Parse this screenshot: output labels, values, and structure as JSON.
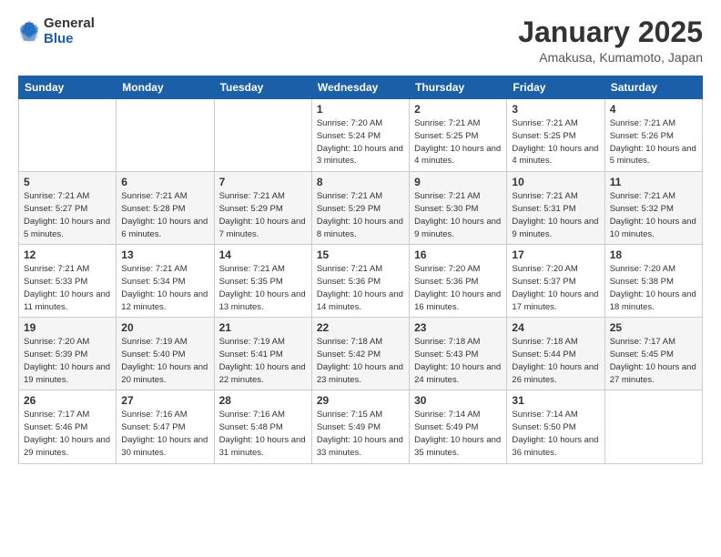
{
  "logo": {
    "general": "General",
    "blue": "Blue"
  },
  "header": {
    "title": "January 2025",
    "location": "Amakusa, Kumamoto, Japan"
  },
  "weekdays": [
    "Sunday",
    "Monday",
    "Tuesday",
    "Wednesday",
    "Thursday",
    "Friday",
    "Saturday"
  ],
  "weeks": [
    [
      {
        "day": "",
        "detail": ""
      },
      {
        "day": "",
        "detail": ""
      },
      {
        "day": "",
        "detail": ""
      },
      {
        "day": "1",
        "detail": "Sunrise: 7:20 AM\nSunset: 5:24 PM\nDaylight: 10 hours\nand 3 minutes."
      },
      {
        "day": "2",
        "detail": "Sunrise: 7:21 AM\nSunset: 5:25 PM\nDaylight: 10 hours\nand 4 minutes."
      },
      {
        "day": "3",
        "detail": "Sunrise: 7:21 AM\nSunset: 5:25 PM\nDaylight: 10 hours\nand 4 minutes."
      },
      {
        "day": "4",
        "detail": "Sunrise: 7:21 AM\nSunset: 5:26 PM\nDaylight: 10 hours\nand 5 minutes."
      }
    ],
    [
      {
        "day": "5",
        "detail": "Sunrise: 7:21 AM\nSunset: 5:27 PM\nDaylight: 10 hours\nand 5 minutes."
      },
      {
        "day": "6",
        "detail": "Sunrise: 7:21 AM\nSunset: 5:28 PM\nDaylight: 10 hours\nand 6 minutes."
      },
      {
        "day": "7",
        "detail": "Sunrise: 7:21 AM\nSunset: 5:29 PM\nDaylight: 10 hours\nand 7 minutes."
      },
      {
        "day": "8",
        "detail": "Sunrise: 7:21 AM\nSunset: 5:29 PM\nDaylight: 10 hours\nand 8 minutes."
      },
      {
        "day": "9",
        "detail": "Sunrise: 7:21 AM\nSunset: 5:30 PM\nDaylight: 10 hours\nand 9 minutes."
      },
      {
        "day": "10",
        "detail": "Sunrise: 7:21 AM\nSunset: 5:31 PM\nDaylight: 10 hours\nand 9 minutes."
      },
      {
        "day": "11",
        "detail": "Sunrise: 7:21 AM\nSunset: 5:32 PM\nDaylight: 10 hours\nand 10 minutes."
      }
    ],
    [
      {
        "day": "12",
        "detail": "Sunrise: 7:21 AM\nSunset: 5:33 PM\nDaylight: 10 hours\nand 11 minutes."
      },
      {
        "day": "13",
        "detail": "Sunrise: 7:21 AM\nSunset: 5:34 PM\nDaylight: 10 hours\nand 12 minutes."
      },
      {
        "day": "14",
        "detail": "Sunrise: 7:21 AM\nSunset: 5:35 PM\nDaylight: 10 hours\nand 13 minutes."
      },
      {
        "day": "15",
        "detail": "Sunrise: 7:21 AM\nSunset: 5:36 PM\nDaylight: 10 hours\nand 14 minutes."
      },
      {
        "day": "16",
        "detail": "Sunrise: 7:20 AM\nSunset: 5:36 PM\nDaylight: 10 hours\nand 16 minutes."
      },
      {
        "day": "17",
        "detail": "Sunrise: 7:20 AM\nSunset: 5:37 PM\nDaylight: 10 hours\nand 17 minutes."
      },
      {
        "day": "18",
        "detail": "Sunrise: 7:20 AM\nSunset: 5:38 PM\nDaylight: 10 hours\nand 18 minutes."
      }
    ],
    [
      {
        "day": "19",
        "detail": "Sunrise: 7:20 AM\nSunset: 5:39 PM\nDaylight: 10 hours\nand 19 minutes."
      },
      {
        "day": "20",
        "detail": "Sunrise: 7:19 AM\nSunset: 5:40 PM\nDaylight: 10 hours\nand 20 minutes."
      },
      {
        "day": "21",
        "detail": "Sunrise: 7:19 AM\nSunset: 5:41 PM\nDaylight: 10 hours\nand 22 minutes."
      },
      {
        "day": "22",
        "detail": "Sunrise: 7:18 AM\nSunset: 5:42 PM\nDaylight: 10 hours\nand 23 minutes."
      },
      {
        "day": "23",
        "detail": "Sunrise: 7:18 AM\nSunset: 5:43 PM\nDaylight: 10 hours\nand 24 minutes."
      },
      {
        "day": "24",
        "detail": "Sunrise: 7:18 AM\nSunset: 5:44 PM\nDaylight: 10 hours\nand 26 minutes."
      },
      {
        "day": "25",
        "detail": "Sunrise: 7:17 AM\nSunset: 5:45 PM\nDaylight: 10 hours\nand 27 minutes."
      }
    ],
    [
      {
        "day": "26",
        "detail": "Sunrise: 7:17 AM\nSunset: 5:46 PM\nDaylight: 10 hours\nand 29 minutes."
      },
      {
        "day": "27",
        "detail": "Sunrise: 7:16 AM\nSunset: 5:47 PM\nDaylight: 10 hours\nand 30 minutes."
      },
      {
        "day": "28",
        "detail": "Sunrise: 7:16 AM\nSunset: 5:48 PM\nDaylight: 10 hours\nand 31 minutes."
      },
      {
        "day": "29",
        "detail": "Sunrise: 7:15 AM\nSunset: 5:49 PM\nDaylight: 10 hours\nand 33 minutes."
      },
      {
        "day": "30",
        "detail": "Sunrise: 7:14 AM\nSunset: 5:49 PM\nDaylight: 10 hours\nand 35 minutes."
      },
      {
        "day": "31",
        "detail": "Sunrise: 7:14 AM\nSunset: 5:50 PM\nDaylight: 10 hours\nand 36 minutes."
      },
      {
        "day": "",
        "detail": ""
      }
    ]
  ]
}
